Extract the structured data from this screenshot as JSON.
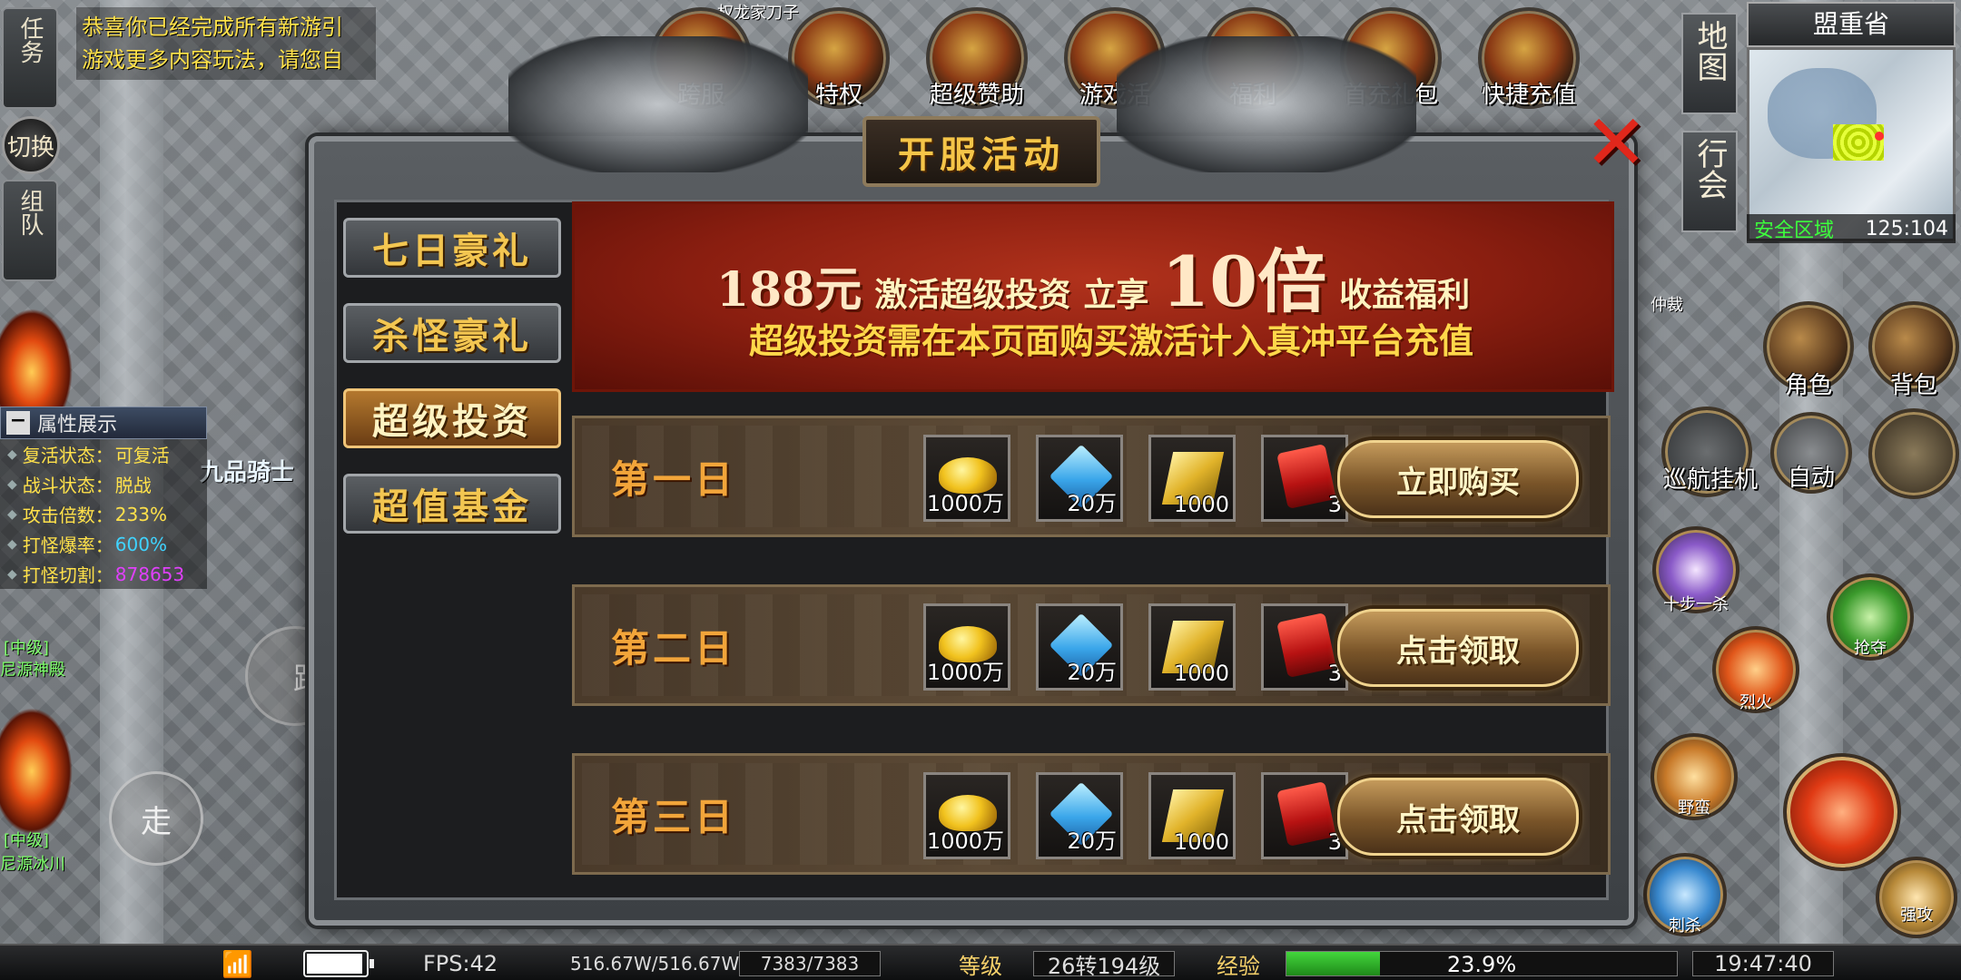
{
  "quest_text": [
    "恭喜你已经完成所有新游引",
    "游戏更多内容玩法，请您自"
  ],
  "left_buttons": {
    "task": "任务",
    "switch": "切换",
    "team": "组队",
    "walk": "走",
    "run": "跑"
  },
  "attributes": {
    "header": "属性展示",
    "rows": [
      {
        "key": "复活状态：",
        "value": "可复活",
        "color": "#ffe14a"
      },
      {
        "key": "战斗状态：",
        "value": "脱战",
        "color": "#ffe14a"
      },
      {
        "key": "攻击倍数：",
        "value": "233%",
        "color": "#ffe14a"
      },
      {
        "key": "打怪爆率：",
        "value": "600%",
        "color": "#3fd3ff"
      },
      {
        "key": "打怪切割：",
        "value": "878653",
        "color": "#e040fb"
      }
    ]
  },
  "world_labels": {
    "top_player": "权龙家刀子",
    "knight": "九品骑士",
    "level_tag_1": "[中级]",
    "level_tag_2": "[中级]",
    "map_name_1": "尼源神殿",
    "map_name_2": "尼源冰川",
    "npc_right": "仲裁"
  },
  "top_icons": [
    "跨服",
    "特权",
    "超级赞助",
    "游戏活",
    "福利",
    "首充礼包",
    "快捷充值"
  ],
  "right_panel": {
    "map_btn": "地图",
    "guild_btn": "行会",
    "region": "盟重省",
    "safe_zone": "安全区域",
    "coords": "125:104",
    "role": "角色",
    "bag": "背包",
    "cruise": "巡航挂机",
    "auto": "自动",
    "skills": [
      "十步一杀",
      "烈火",
      "野蛮",
      "刺杀",
      "强攻",
      "抢夺"
    ]
  },
  "dialog": {
    "title": "开服活动",
    "close_icon": "close-x-icon",
    "tabs": [
      {
        "label": "七日豪礼",
        "active": false
      },
      {
        "label": "杀怪豪礼",
        "active": false
      },
      {
        "label": "超级投资",
        "active": true
      },
      {
        "label": "超值基金",
        "active": false
      }
    ],
    "banner": {
      "price": "188元",
      "activate": "激活超级投资",
      "enjoy": "立享",
      "multiplier": "10倍",
      "benefit": "收益福利",
      "note": "超级投资需在本页面购买激活计入真冲平台充值"
    },
    "days": [
      {
        "label": "第一日",
        "button": "立即购买",
        "rewards": [
          {
            "icon": "gold-ingot-icon",
            "qty": "1000万"
          },
          {
            "icon": "diamond-icon",
            "qty": "20万"
          },
          {
            "icon": "gold-ticket-icon",
            "qty": "1000"
          },
          {
            "icon": "red-envelope-icon",
            "qty": "3"
          }
        ]
      },
      {
        "label": "第二日",
        "button": "点击领取",
        "rewards": [
          {
            "icon": "gold-ingot-icon",
            "qty": "1000万"
          },
          {
            "icon": "diamond-icon",
            "qty": "20万"
          },
          {
            "icon": "gold-ticket-icon",
            "qty": "1000"
          },
          {
            "icon": "red-envelope-icon",
            "qty": "3"
          }
        ]
      },
      {
        "label": "第三日",
        "button": "点击领取",
        "rewards": [
          {
            "icon": "gold-ingot-icon",
            "qty": "1000万"
          },
          {
            "icon": "diamond-icon",
            "qty": "20万"
          },
          {
            "icon": "gold-ticket-icon",
            "qty": "1000"
          },
          {
            "icon": "red-envelope-icon",
            "qty": "3"
          }
        ]
      }
    ]
  },
  "status_bar": {
    "fps": "FPS:42",
    "hp": "516.67W/516.67W",
    "mp": "7383/7383",
    "level_label": "等级",
    "level": "26转194级",
    "exp_label": "经验",
    "exp": "23.9%",
    "exp_fraction": 0.239,
    "time": "19:47:40",
    "battery_fraction": 0.95
  }
}
